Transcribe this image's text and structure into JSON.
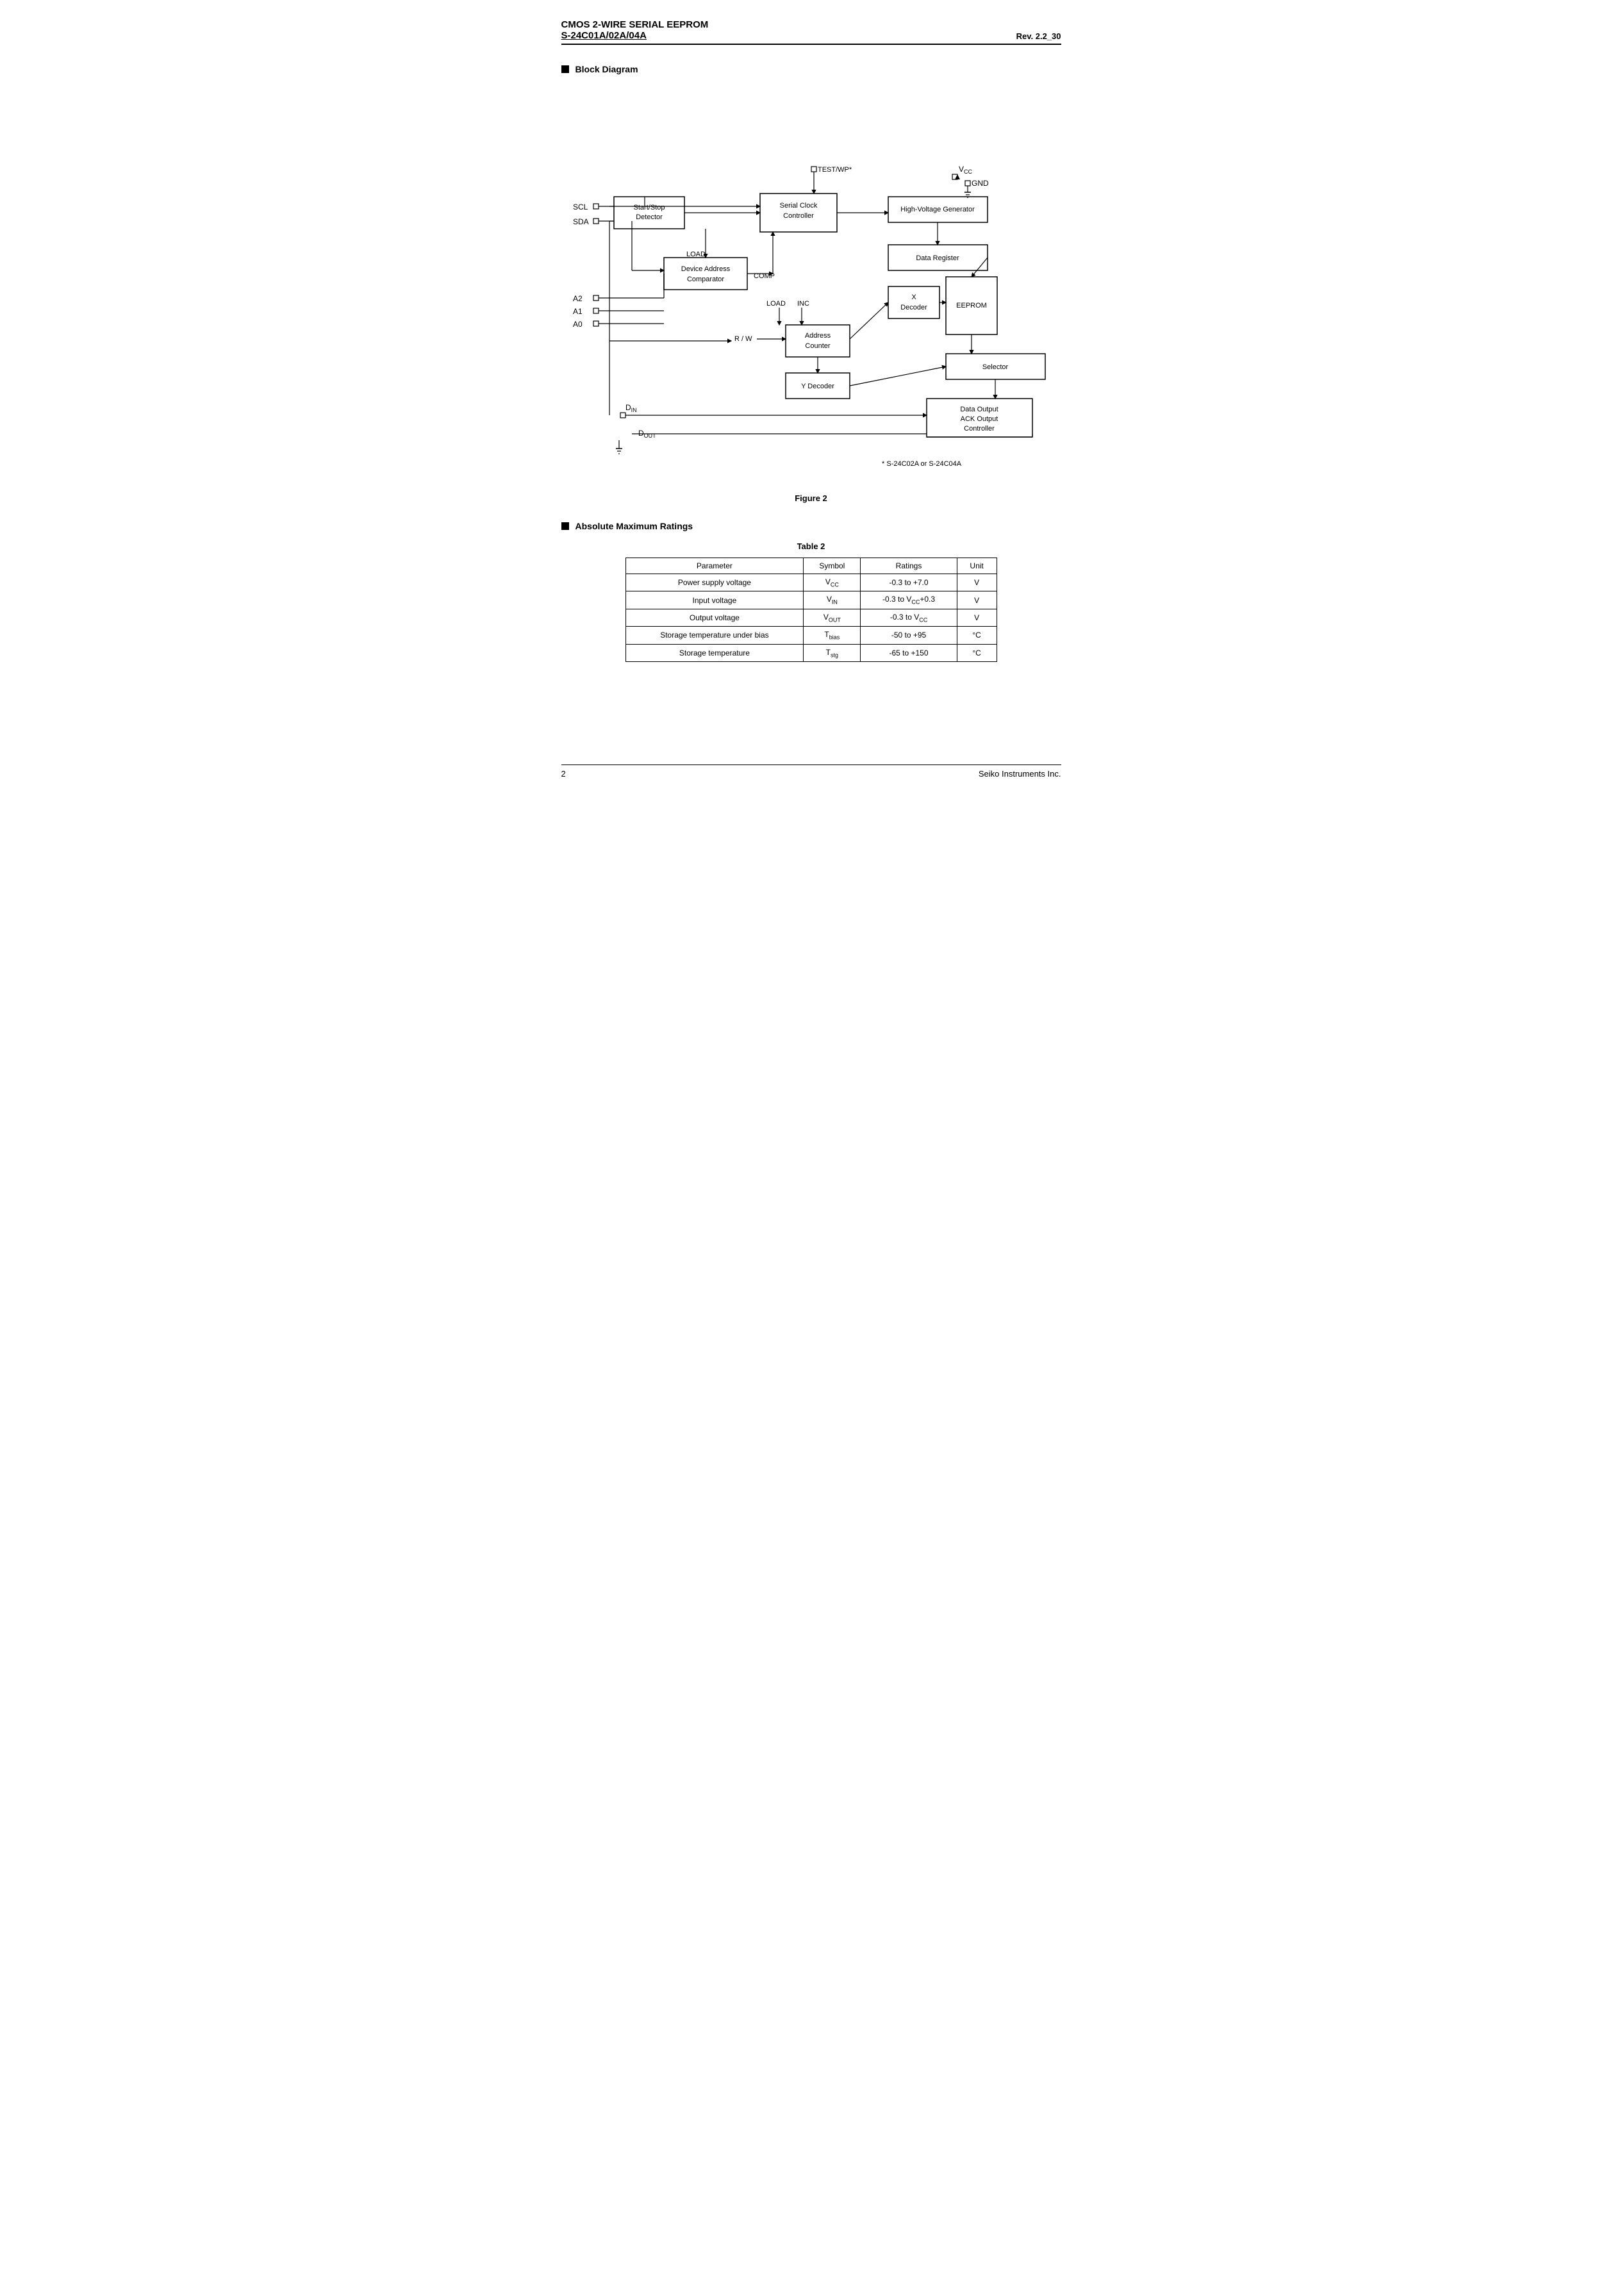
{
  "header": {
    "line1": "CMOS 2-WIRE SERIAL  EEPROM",
    "line2": "S-24C01A/02A/04A",
    "rev": "Rev. 2.2_30"
  },
  "sections": {
    "block_diagram": {
      "heading": "Block Diagram",
      "figure_caption": "Figure 2"
    },
    "ratings": {
      "heading": "Absolute Maximum Ratings",
      "table_caption": "Table  2",
      "columns": [
        "Parameter",
        "Symbol",
        "Ratings",
        "Unit"
      ],
      "rows": [
        [
          "Power supply voltage",
          "V_CC",
          "-0.3 to +7.0",
          "V"
        ],
        [
          "Input voltage",
          "V_IN",
          "-0.3 to V_CC+0.3",
          "V"
        ],
        [
          "Output voltage",
          "V_OUT",
          "-0.3 to V_CC",
          "V"
        ],
        [
          "Storage temperature under bias",
          "T_bias",
          "-50 to +95",
          "°C"
        ],
        [
          "Storage temperature",
          "T_stg",
          "-65 to +150",
          "°C"
        ]
      ]
    }
  },
  "footer": {
    "page": "2",
    "company": "Seiko Instruments Inc."
  }
}
